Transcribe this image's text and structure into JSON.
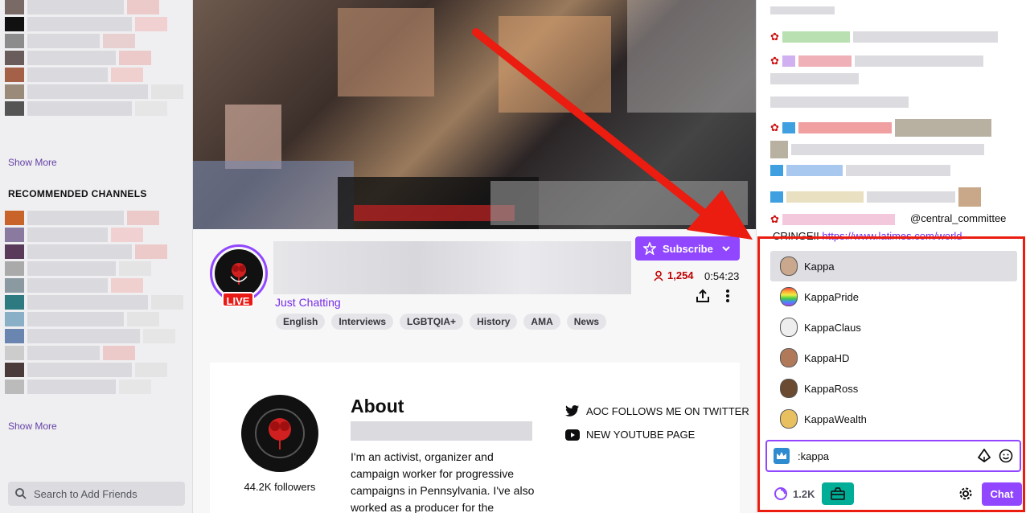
{
  "sidebar": {
    "show_more_1": "Show More",
    "recommended_heading": "RECOMMENDED CHANNELS",
    "show_more_2": "Show More",
    "search_placeholder": "Search to Add Friends"
  },
  "stream": {
    "live_label": "LIVE",
    "category": "Just Chatting",
    "tags": [
      "English",
      "Interviews",
      "LGBTQIA+",
      "History",
      "AMA",
      "News"
    ],
    "subscribe_label": "Subscribe",
    "viewer_count": "1,254",
    "uptime": "0:54:23"
  },
  "about": {
    "title": "About",
    "followers": "44.2K followers",
    "bio": "I'm an activist, organizer and campaign worker for progressive campaigns in Pennsylvania. I've also worked as a producer for the",
    "links": [
      "AOC FOLLOWS ME ON TWITTER",
      "NEW YOUTUBE PAGE"
    ]
  },
  "chat": {
    "mention": "@central_committee",
    "cringe_prefix": "CRINGE!! ",
    "cringe_link": "https://www.latimes.com/world-",
    "emote_suggestions": [
      "Kappa",
      "KappaPride",
      "KappaClaus",
      "KappaHD",
      "KappaRoss",
      "KappaWealth"
    ],
    "input_value": ":kappa",
    "points": "1.2K",
    "chat_button": "Chat"
  },
  "colors": {
    "accent": "#9147ff",
    "live": "#e91916",
    "annotation": "#eb1c10"
  }
}
